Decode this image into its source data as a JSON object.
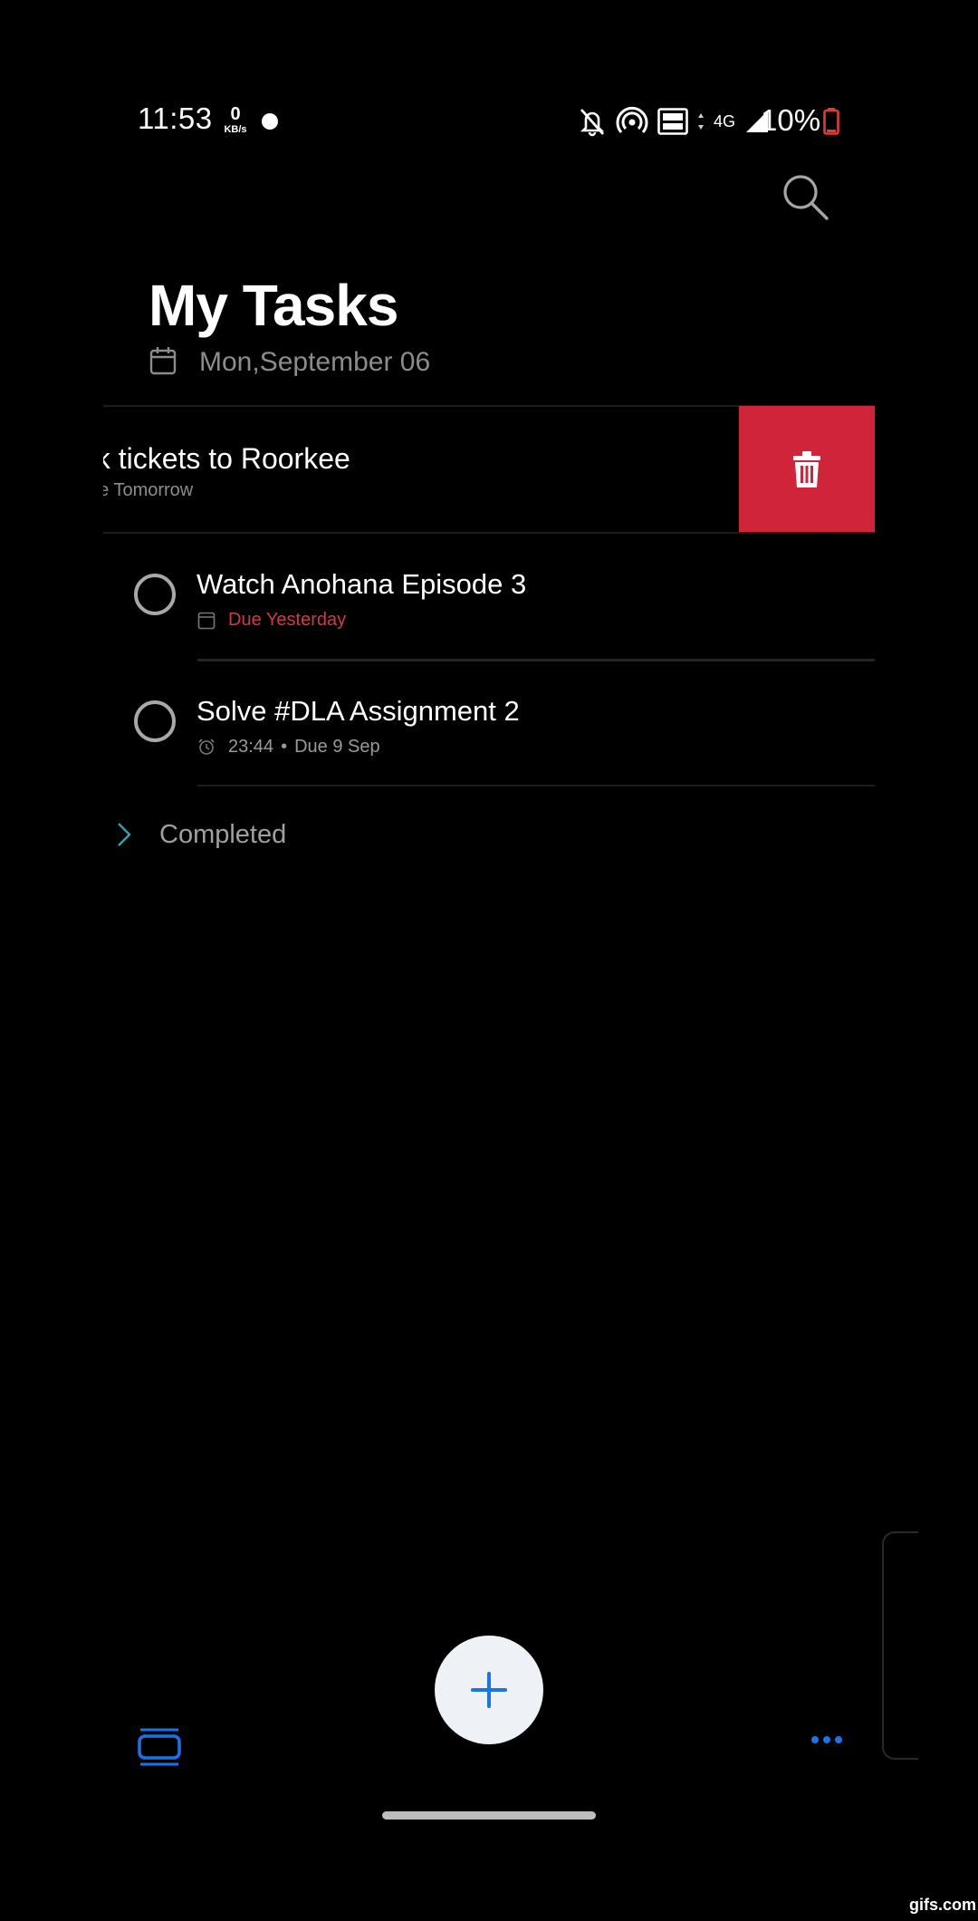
{
  "status_bar": {
    "time": "11:53",
    "net_speed_value": "0",
    "net_speed_unit": "KB/s",
    "network_type": "4G",
    "battery_percent": "10%",
    "battery_color": "#e53935"
  },
  "header": {
    "title": "My Tasks",
    "date": "Mon,September 06"
  },
  "tasks": [
    {
      "title": "ok tickets to Roorkee",
      "due": "ue Tomorrow",
      "swiped": true,
      "delete_icon": "trash-icon"
    },
    {
      "title": "Watch Anohana Episode 3",
      "due": "Due Yesterday",
      "meta_icon": "calendar-icon",
      "overdue": true
    },
    {
      "title": "Solve #DLA Assignment 2",
      "reminder_time": "23:44",
      "separator": "•",
      "due": "Due 9 Sep",
      "meta_icon": "alarm-icon"
    }
  ],
  "completed_section": {
    "label": "Completed",
    "icon": "chevron-right-icon"
  },
  "bottom_bar": {
    "add_icon": "plus-icon",
    "lists_icon": "lists-icon",
    "more_icon": "more-dots-icon"
  },
  "colors": {
    "background": "#000000",
    "accent": "#1a73e8",
    "delete": "#cf2439",
    "overdue": "#d23a47"
  },
  "watermark": "gifs.com"
}
